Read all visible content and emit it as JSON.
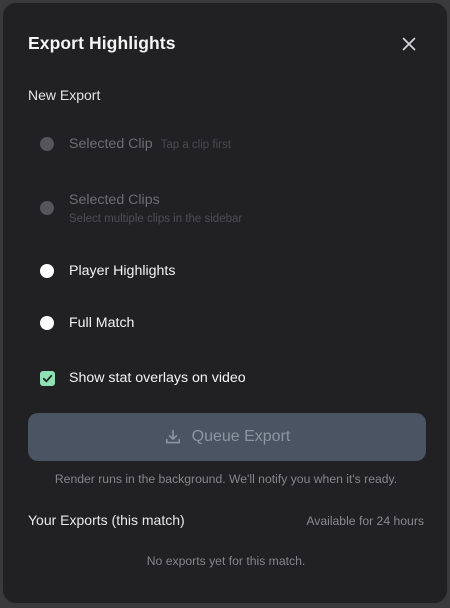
{
  "modal": {
    "title": "Export Highlights",
    "close_icon": "close-icon"
  },
  "new_export": {
    "section_label": "New Export",
    "options": [
      {
        "label": "Selected Clip",
        "hint": "Tap a clip first",
        "enabled": false,
        "selected": false
      },
      {
        "label": "Selected Clips",
        "hint": "Select multiple clips in the sidebar",
        "enabled": false,
        "selected": false
      },
      {
        "label": "Player Highlights",
        "enabled": true,
        "selected": false
      },
      {
        "label": "Full Match",
        "enabled": true,
        "selected": false
      }
    ],
    "overlay_checkbox": {
      "label": "Show stat overlays on video",
      "checked": true
    }
  },
  "queue": {
    "button_label": "Queue Export",
    "button_icon": "download-icon",
    "enabled": false,
    "note": "Render runs in the background. We'll notify you when it's ready."
  },
  "exports": {
    "title": "Your Exports (this match)",
    "availability": "Available for 24 hours",
    "empty_message": "No exports yet for this match."
  },
  "colors": {
    "accent_checkbox": "#8fe0b5",
    "button_bg": "#4b5463",
    "modal_bg": "#212123"
  }
}
